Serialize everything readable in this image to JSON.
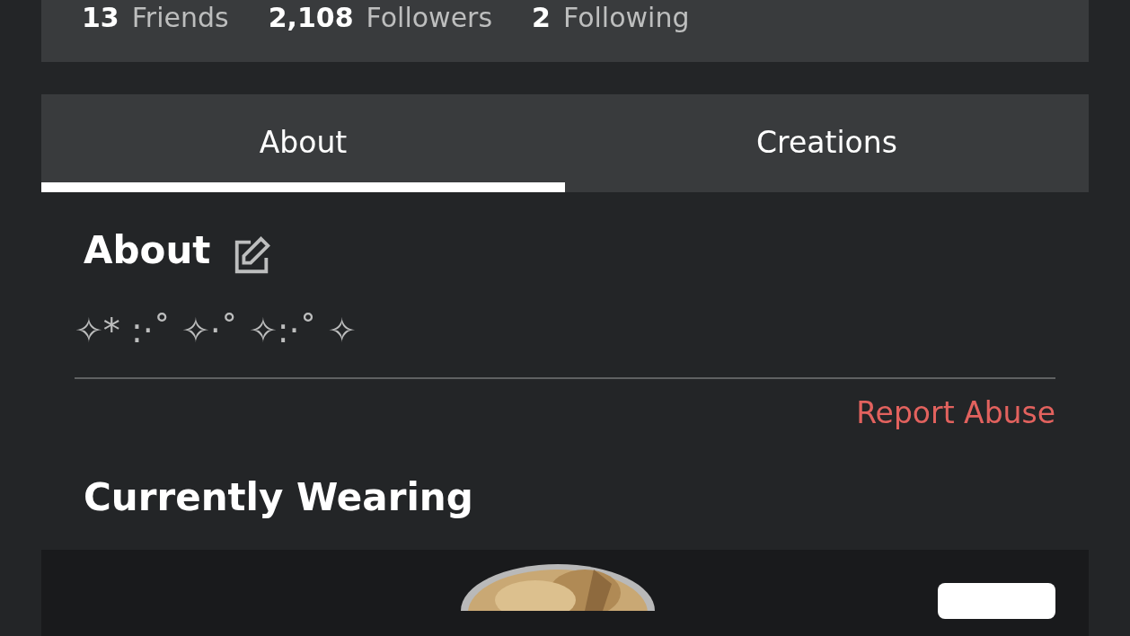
{
  "stats": [
    {
      "count": "13",
      "label": "Friends"
    },
    {
      "count": "2,108",
      "label": "Followers"
    },
    {
      "count": "2",
      "label": "Following"
    }
  ],
  "tabs": [
    {
      "label": "About",
      "selected": true
    },
    {
      "label": "Creations",
      "selected": false
    }
  ],
  "about": {
    "title": "About",
    "text": "✧* :·˚ ✧·˚ ✧:·˚ ✧",
    "report": "Report Abuse"
  },
  "wearing": {
    "title": "Currently Wearing"
  }
}
